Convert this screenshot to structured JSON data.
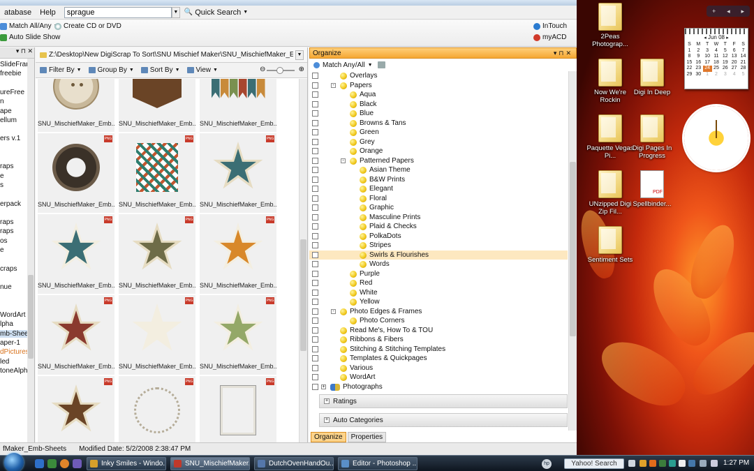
{
  "menu": {
    "database": "atabase",
    "help": "Help"
  },
  "search": {
    "value": "sprague",
    "quick_search": "Quick Search"
  },
  "toolbar": {
    "match_all": "Match All/Any",
    "create_cd": "Create CD or DVD",
    "auto_slide": "Auto Slide Show",
    "intouch": "InTouch",
    "myacd": "myACD"
  },
  "left_items": [
    "SlideFram",
    "freebie",
    "",
    "ureFree",
    "n",
    "ape",
    "ellum",
    "",
    "ers v.1",
    "",
    "",
    "raps",
    "e",
    "s",
    "",
    "erpack",
    "",
    "raps",
    "raps",
    "os",
    "e",
    "",
    "craps",
    "",
    "nue",
    "",
    "",
    "WordArt",
    "lpha",
    "mb-Shee",
    "aper-1",
    "dPictures",
    "led",
    "toneAlph"
  ],
  "path": "Z:\\Desktop\\New DigiScrap To Sort\\SNU Mischief Maker\\SNU_MischiefMaker_Emb-Sheets",
  "viewbar": {
    "filter": "Filter By",
    "group": "Group By",
    "sort": "Sort By",
    "view": "View"
  },
  "thumbnails": [
    {
      "caption": "SNU_MischiefMaker_Emb...",
      "kind": "button",
      "png": false
    },
    {
      "caption": "SNU_MischiefMaker_Emb...",
      "kind": "pocket",
      "png": false
    },
    {
      "caption": "SNU_MischiefMaker_Emb...",
      "kind": "banner",
      "png": false
    },
    {
      "caption": "SNU_MischiefMaker_Emb...",
      "kind": "ring",
      "png": true
    },
    {
      "caption": "SNU_MischiefMaker_Emb...",
      "kind": "sheet",
      "png": true
    },
    {
      "caption": "SNU_MischiefMaker_Emb...",
      "kind": "star-teal",
      "png": true
    },
    {
      "caption": "SNU_MischiefMaker_Emb...",
      "kind": "star-teal-light",
      "png": true
    },
    {
      "caption": "SNU_MischiefMaker_Emb...",
      "kind": "star-olive",
      "png": true
    },
    {
      "caption": "SNU_MischiefMaker_Emb...",
      "kind": "star-orange",
      "png": true
    },
    {
      "caption": "SNU_MischiefMaker_Emb...",
      "kind": "star-red",
      "png": true
    },
    {
      "caption": "SNU_MischiefMaker_Emb...",
      "kind": "star-outline",
      "png": true
    },
    {
      "caption": "SNU_MischiefMaker_Emb...",
      "kind": "star-green",
      "png": true
    },
    {
      "caption": "",
      "kind": "star-brown",
      "png": true
    },
    {
      "caption": "",
      "kind": "frame-circle",
      "png": true
    },
    {
      "caption": "",
      "kind": "frame-rect",
      "png": true
    }
  ],
  "organize": {
    "title": "Organize",
    "match": "Match Any/All",
    "tree": [
      {
        "label": "Overlays",
        "level": 1,
        "exp": ""
      },
      {
        "label": "Papers",
        "level": 1,
        "exp": "-"
      },
      {
        "label": "Aqua",
        "level": 2,
        "exp": ""
      },
      {
        "label": "Black",
        "level": 2,
        "exp": ""
      },
      {
        "label": "Blue",
        "level": 2,
        "exp": ""
      },
      {
        "label": "Browns & Tans",
        "level": 2,
        "exp": ""
      },
      {
        "label": "Green",
        "level": 2,
        "exp": ""
      },
      {
        "label": "Grey",
        "level": 2,
        "exp": ""
      },
      {
        "label": "Orange",
        "level": 2,
        "exp": ""
      },
      {
        "label": "Patterned Papers",
        "level": 2,
        "exp": "-"
      },
      {
        "label": "Asian Theme",
        "level": 3,
        "exp": ""
      },
      {
        "label": "B&W Prints",
        "level": 3,
        "exp": ""
      },
      {
        "label": "Elegant",
        "level": 3,
        "exp": ""
      },
      {
        "label": "Floral",
        "level": 3,
        "exp": ""
      },
      {
        "label": "Graphic",
        "level": 3,
        "exp": ""
      },
      {
        "label": "Masculine Prints",
        "level": 3,
        "exp": ""
      },
      {
        "label": "Plaid & Checks",
        "level": 3,
        "exp": ""
      },
      {
        "label": "PolkaDots",
        "level": 3,
        "exp": ""
      },
      {
        "label": "Stripes",
        "level": 3,
        "exp": ""
      },
      {
        "label": "Swirls & Flourishes",
        "level": 3,
        "exp": "",
        "selected": true
      },
      {
        "label": "Words",
        "level": 3,
        "exp": ""
      },
      {
        "label": "Purple",
        "level": 2,
        "exp": ""
      },
      {
        "label": "Red",
        "level": 2,
        "exp": ""
      },
      {
        "label": "White",
        "level": 2,
        "exp": ""
      },
      {
        "label": "Yellow",
        "level": 2,
        "exp": ""
      },
      {
        "label": "Photo Edges & Frames",
        "level": 1,
        "exp": "-"
      },
      {
        "label": "Photo Corners",
        "level": 2,
        "exp": ""
      },
      {
        "label": "Read Me's, How To & TOU",
        "level": 1,
        "exp": ""
      },
      {
        "label": "Ribbons & Fibers",
        "level": 1,
        "exp": ""
      },
      {
        "label": "Stitching & Stitching Templates",
        "level": 1,
        "exp": ""
      },
      {
        "label": "Templates & Quickpages",
        "level": 1,
        "exp": ""
      },
      {
        "label": "Various",
        "level": 1,
        "exp": ""
      },
      {
        "label": "WordArt",
        "level": 1,
        "exp": ""
      },
      {
        "label": "Photographs",
        "level": 0,
        "exp": "+",
        "people": true
      }
    ],
    "ratings": "Ratings",
    "auto_categories": "Auto Categories",
    "tab_organize": "Organize",
    "tab_properties": "Properties"
  },
  "status": {
    "name": "fMaker_Emb-Sheets",
    "modified": "Modified Date: 5/2/2008 2:38:47 PM"
  },
  "desktop_icons": [
    {
      "label": "2Peas Photograp...",
      "type": "folder"
    },
    {
      "label": "Now We're Rockin",
      "type": "folder"
    },
    {
      "label": "Digi In Deep",
      "type": "folder"
    },
    {
      "label": "Paquette Vegas Pi...",
      "type": "folder"
    },
    {
      "label": "Digi Pages In Progress",
      "type": "folder"
    },
    {
      "label": "UNzipped Digi Zip Fil...",
      "type": "folder"
    },
    {
      "label": "Spellbinder...",
      "type": "pdf"
    },
    {
      "label": "Sentiment Sets",
      "type": "folder"
    }
  ],
  "calendar": {
    "month": "Jun 08",
    "days": [
      "S",
      "M",
      "T",
      "W",
      "T",
      "F",
      "S"
    ],
    "weeks": [
      [
        "1",
        "2",
        "3",
        "4",
        "5",
        "6",
        "7"
      ],
      [
        "8",
        "9",
        "10",
        "11",
        "12",
        "13",
        "14"
      ],
      [
        "15",
        "16",
        "17",
        "18",
        "19",
        "20",
        "21"
      ],
      [
        "22",
        "23",
        "24",
        "25",
        "26",
        "27",
        "28"
      ],
      [
        "29",
        "30",
        "1",
        "2",
        "3",
        "4",
        "5"
      ]
    ],
    "today": "24"
  },
  "taskbar": {
    "tasks": [
      "Inky Smiles - Windo...",
      "SNU_MischiefMaker...",
      "DutchOvenHandOu...",
      "Editor - Photoshop ..."
    ],
    "yahoo": "Yahoo! Search",
    "time": "1:27 PM"
  },
  "colors": {
    "accent": "#f5a733",
    "selection": "#fde8c0",
    "taskbar": "#1b2634"
  }
}
